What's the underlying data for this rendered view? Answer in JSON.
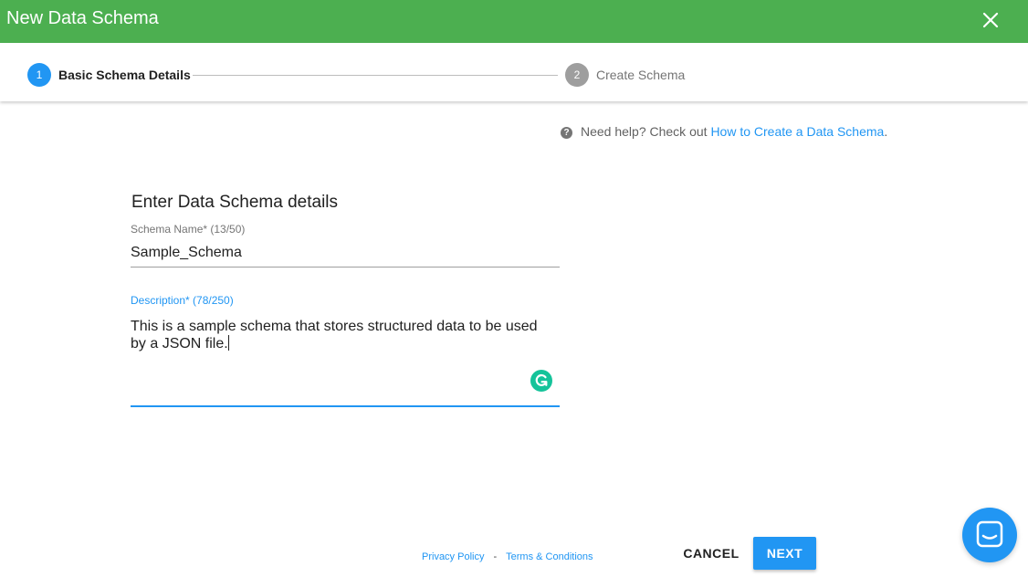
{
  "window": {
    "title": "New Data Schema",
    "close_icon": "close-icon"
  },
  "stepper": {
    "steps": [
      {
        "number": "1",
        "label": "Basic Schema Details",
        "state": "active",
        "color": "#2196f3"
      },
      {
        "number": "2",
        "label": "Create Schema",
        "state": "inactive",
        "color": "#9e9e9e"
      }
    ]
  },
  "help": {
    "icon": "help-icon",
    "text": "Need help? Check out ",
    "link_text": "How to Create a Data Schema",
    "suffix": "."
  },
  "form": {
    "heading": "Enter Data Schema details",
    "schema_name": {
      "label": "Schema Name* (13/50)",
      "value": "Sample_Schema"
    },
    "description": {
      "label": "Description* (78/250)",
      "value": "This is a sample schema that stores structured data to be used by a JSON file."
    }
  },
  "footer": {
    "privacy_policy": "Privacy Policy",
    "separator": "-",
    "terms": "Terms & Conditions"
  },
  "actions": {
    "cancel_label": "CANCEL",
    "next_label": "NEXT"
  },
  "colors": {
    "header": "#4caf50",
    "accent": "#2196f3",
    "grammarly": "#15c39a"
  },
  "chat": {
    "icon": "chat-icon"
  }
}
